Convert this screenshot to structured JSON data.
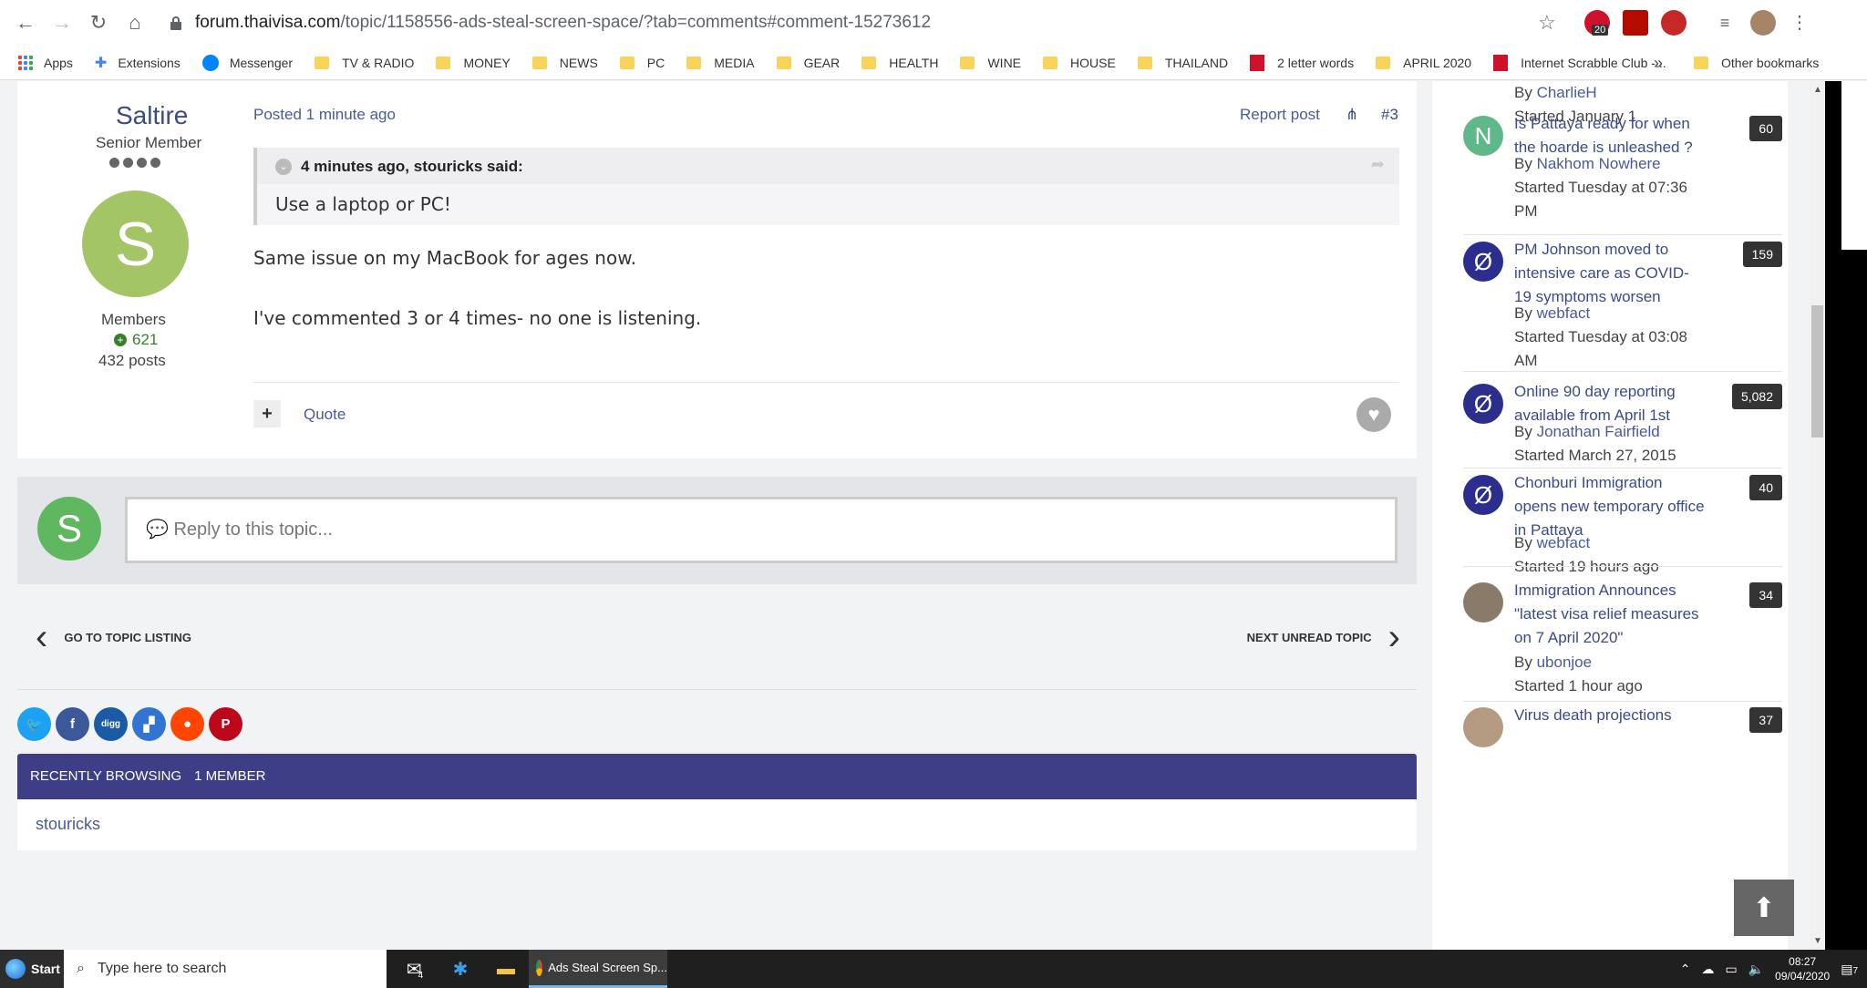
{
  "browser": {
    "url_host": "forum.thaivisa.com",
    "url_path": "/topic/1158556-ads-steal-screen-space/?tab=comments#comment-15273612",
    "ext_badge_1": "20",
    "bookmarks": [
      {
        "label": "Apps",
        "icon": "apps"
      },
      {
        "label": "Extensions",
        "icon": "puzzle"
      },
      {
        "label": "Messenger",
        "icon": "messenger"
      },
      {
        "label": "TV & RADIO",
        "icon": "folder"
      },
      {
        "label": "MONEY",
        "icon": "folder"
      },
      {
        "label": "NEWS",
        "icon": "folder"
      },
      {
        "label": "PC",
        "icon": "folder"
      },
      {
        "label": "MEDIA",
        "icon": "folder"
      },
      {
        "label": "GEAR",
        "icon": "folder"
      },
      {
        "label": "HEALTH",
        "icon": "folder"
      },
      {
        "label": "WINE",
        "icon": "folder"
      },
      {
        "label": "HOUSE",
        "icon": "folder"
      },
      {
        "label": "THAILAND",
        "icon": "folder"
      },
      {
        "label": "2 letter words",
        "icon": "red"
      },
      {
        "label": "APRIL 2020",
        "icon": "folder"
      },
      {
        "label": "Internet Scrabble Club -...",
        "icon": "red"
      }
    ],
    "more_bookmarks": "»",
    "other_bookmarks": "Other bookmarks"
  },
  "post": {
    "author": "Saltire",
    "title": "Senior Member",
    "avatar_letter": "S",
    "group": "Members",
    "reputation": "621",
    "posts": "432 posts",
    "posted": "Posted 1 minute ago",
    "report": "Report post",
    "number": "#3",
    "quote_header": "4 minutes ago, stouricks said:",
    "quote_body": "Use a laptop or PC!",
    "body_line_1": "Same issue on my MacBook for ages now.",
    "body_line_2": "I've commented 3 or 4 times- no one is listening.",
    "multiquote": "+",
    "quote_label": "Quote"
  },
  "reply": {
    "avatar_letter": "S",
    "placeholder": "💬 Reply to this topic..."
  },
  "topic_nav": {
    "prev": "GO TO TOPIC LISTING",
    "next": "NEXT UNREAD TOPIC"
  },
  "share_icons": [
    {
      "name": "twitter",
      "glyph": "🐦",
      "color": "#1da1f2"
    },
    {
      "name": "facebook",
      "glyph": "f",
      "color": "#3b5998"
    },
    {
      "name": "digg",
      "glyph": "digg",
      "color": "#1a5ba6"
    },
    {
      "name": "delicious",
      "glyph": "▞",
      "color": "#3274d1"
    },
    {
      "name": "reddit",
      "glyph": "●",
      "color": "#ff4500"
    },
    {
      "name": "pinterest",
      "glyph": "P",
      "color": "#bd081c"
    }
  ],
  "recently_browsing": {
    "label": "RECENTLY BROWSING",
    "count": "1 MEMBER",
    "member": "stouricks"
  },
  "sidebar": {
    "top_by": "By",
    "top_author": "CharlieH",
    "top_started": "Started January 1",
    "topics": [
      {
        "title": "Is Pattaya ready for when the hoarde is unleashed ?",
        "by": "By",
        "author": "Nakhom Nowhere",
        "started": "Started Tuesday at 07:36 PM",
        "count": "60",
        "avatar": "N",
        "avatar_color": "#5fb88a"
      },
      {
        "title": "PM Johnson moved to intensive care as COVID-19 symptoms worsen",
        "by": "By",
        "author": "webfact",
        "started": "Started Tuesday at 03:08 AM",
        "count": "159",
        "avatar": "Ø",
        "avatar_color": "#2b2e8c"
      },
      {
        "title": "Online 90 day reporting available from April 1st",
        "by": "By",
        "author": "Jonathan Fairfield",
        "started": "Started March 27, 2015",
        "count": "5,082",
        "avatar": "Ø",
        "avatar_color": "#2b2e8c"
      },
      {
        "title": "Chonburi Immigration opens new temporary office in Pattaya",
        "by": "By",
        "author": "webfact",
        "started": "Started 19 hours ago",
        "count": "40",
        "avatar": "Ø",
        "avatar_color": "#2b2e8c"
      },
      {
        "title": "Immigration Announces \"latest visa relief measures on 7 April 2020\"",
        "by": "By",
        "author": "ubonjoe",
        "started": "Started 1 hour ago",
        "count": "34",
        "avatar": "",
        "avatar_color": "#8a7a6a"
      },
      {
        "title": "Virus death projections",
        "by": "",
        "author": "",
        "started": "",
        "count": "37",
        "avatar": "",
        "avatar_color": "#b59a82"
      }
    ]
  },
  "taskbar": {
    "start": "Start",
    "search_placeholder": "Type here to search",
    "mail_badge": "4",
    "task_title": "Ads Steal Screen Sp...",
    "time": "08:27",
    "date": "09/04/2020",
    "notif_count": "7"
  }
}
